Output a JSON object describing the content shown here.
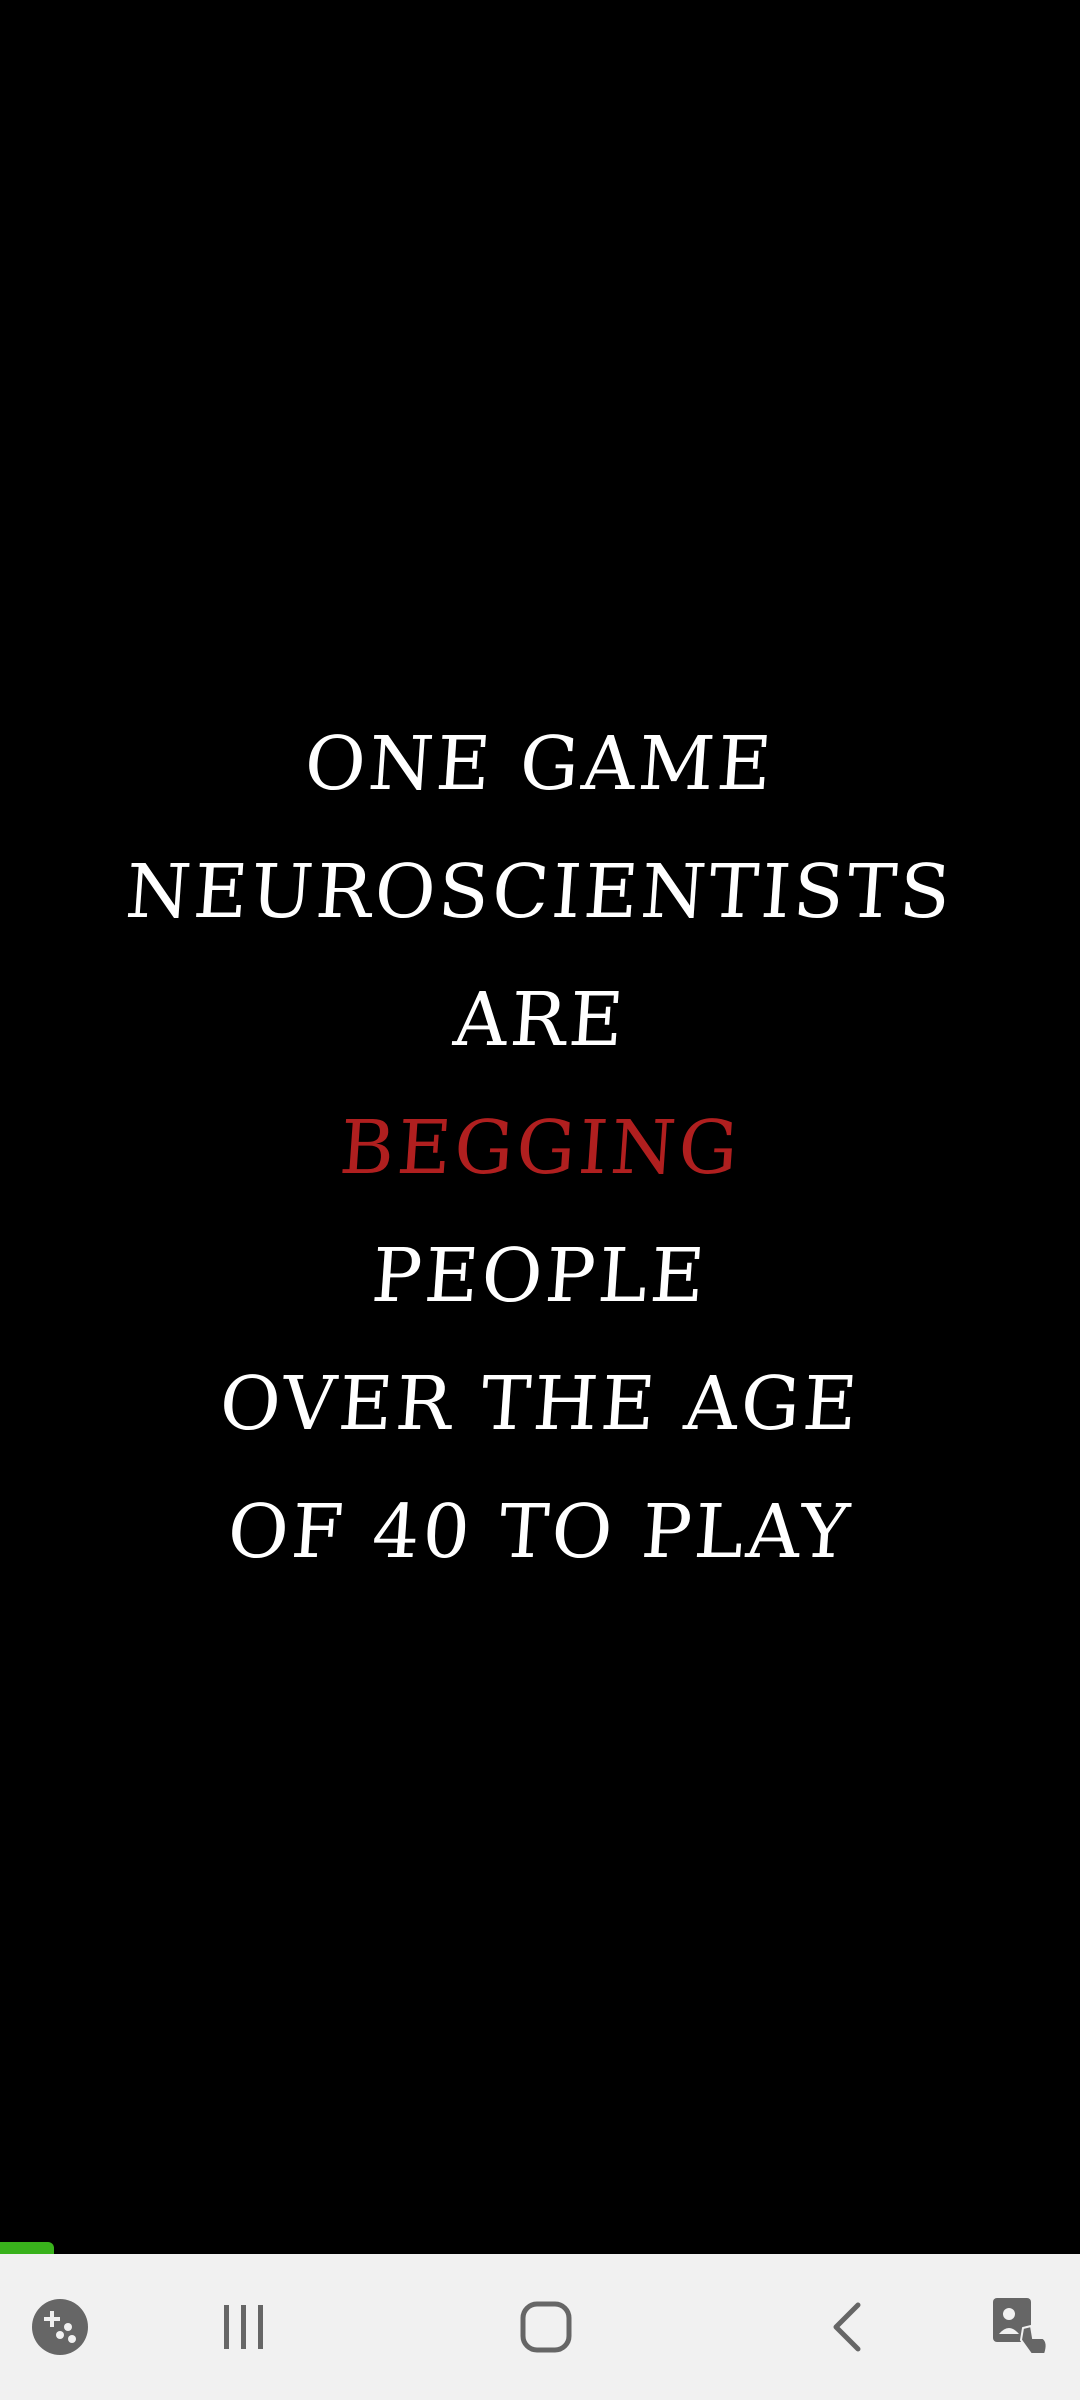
{
  "headline": {
    "lines": [
      {
        "text": "ONE GAME"
      },
      {
        "text": "NEUROSCIENTISTS"
      },
      {
        "text": "ARE"
      },
      {
        "text": "BEGGING"
      },
      {
        "text": "PEOPLE"
      },
      {
        "text": "OVER THE AGE"
      },
      {
        "text": "OF 40 TO PLAY"
      }
    ],
    "accent_line_index": 3
  },
  "colors": {
    "background": "#000000",
    "text": "#ffffff",
    "accent": "#b01f1f",
    "progress": "#39b21c",
    "nav_bar": "#f1f1f1",
    "nav_icon": "#666666"
  },
  "progress": {
    "fraction": 0.05
  },
  "nav_bar": {
    "buttons": [
      {
        "icon": "game-launcher-icon"
      },
      {
        "icon": "recent-apps-icon"
      },
      {
        "icon": "home-icon"
      },
      {
        "icon": "back-icon"
      },
      {
        "icon": "accessibility-icon"
      }
    ]
  }
}
